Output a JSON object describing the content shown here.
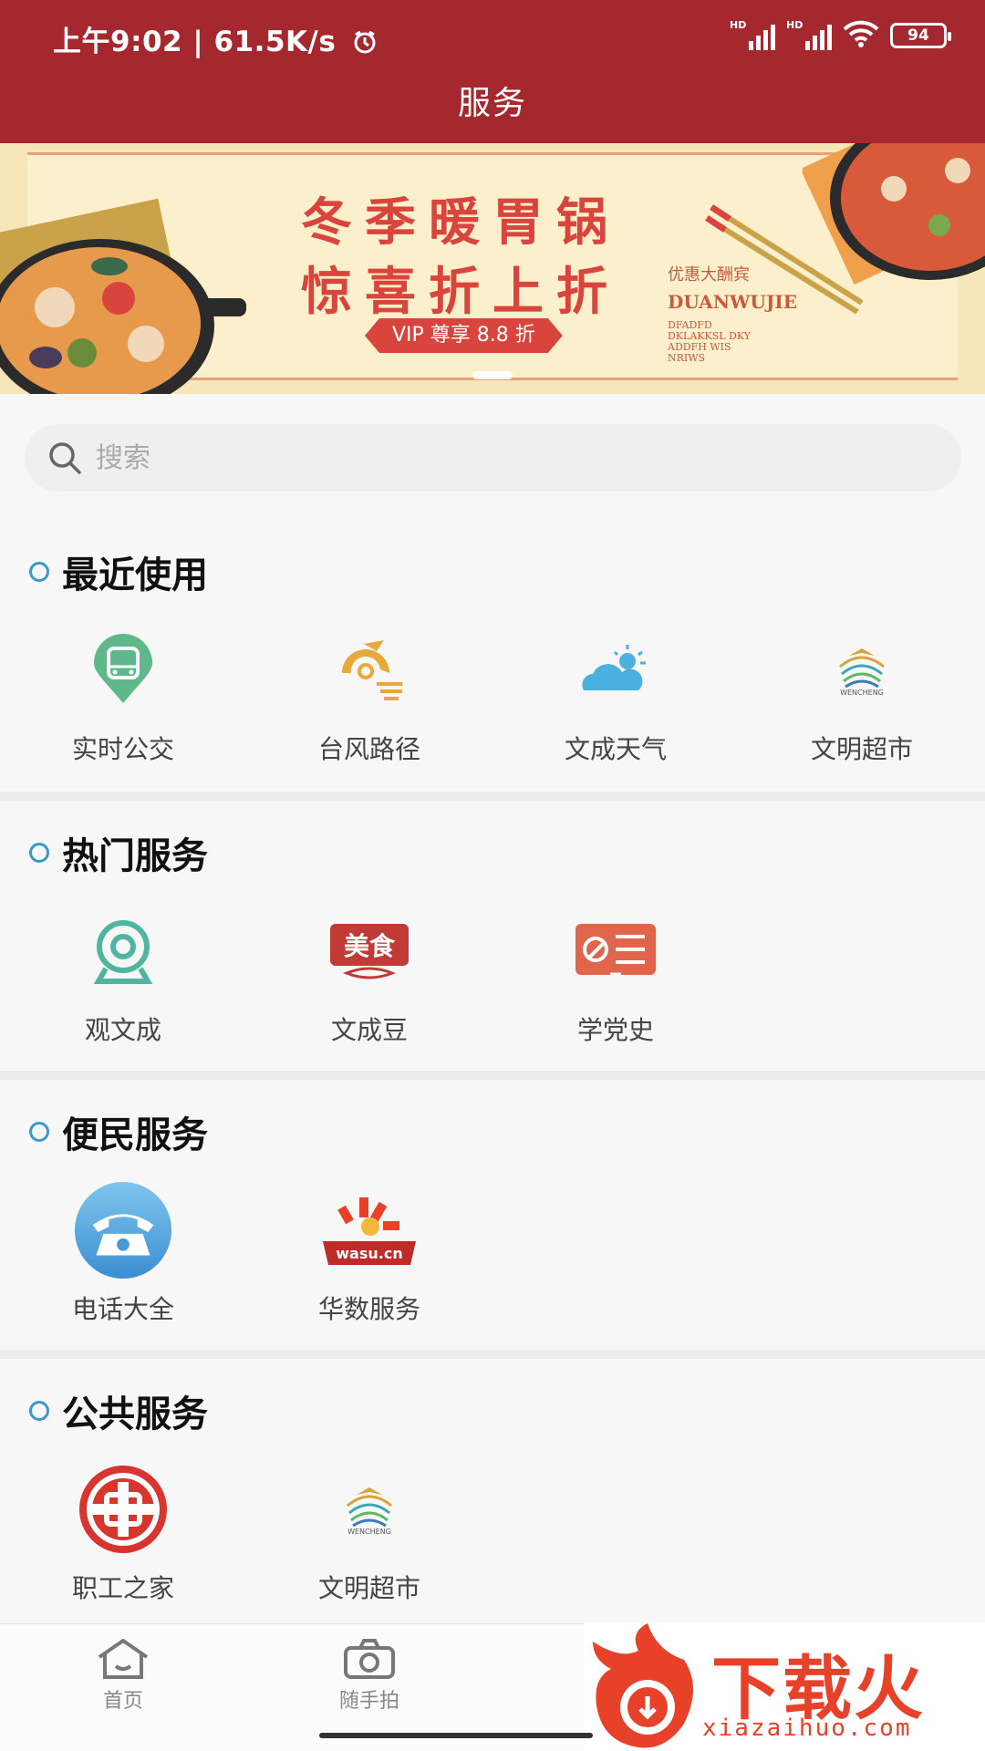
{
  "status_bar": {
    "time": "上午9:02",
    "speed": "61.5K/s",
    "signal_label": "HD",
    "battery": "94"
  },
  "header": {
    "title": "服务"
  },
  "banner": {
    "line1": "冬季暖胃锅",
    "line2": "惊喜折上折",
    "vip": "VIP 尊享 8.8 折",
    "brand_cn": "优惠大酬宾",
    "brand_en": "DUANWUJIE",
    "small_text": "DFADFD DKLAKKSL DKY ADDFH WIS NRIWS"
  },
  "search": {
    "placeholder": "搜索"
  },
  "sections": [
    {
      "title": "最近使用",
      "items": [
        {
          "label": "实时公交",
          "icon": "bus-icon"
        },
        {
          "label": "台风路径",
          "icon": "typhoon-icon"
        },
        {
          "label": "文成天气",
          "icon": "weather-icon"
        },
        {
          "label": "文明超市",
          "icon": "wencheng-logo-icon"
        }
      ]
    },
    {
      "title": "热门服务",
      "items": [
        {
          "label": "观文成",
          "icon": "webcam-icon"
        },
        {
          "label": "文成豆",
          "icon": "food-icon"
        },
        {
          "label": "学党史",
          "icon": "party-history-icon"
        }
      ]
    },
    {
      "title": "便民服务",
      "items": [
        {
          "label": "电话大全",
          "icon": "telephone-icon"
        },
        {
          "label": "华数服务",
          "icon": "wasu-icon",
          "logo_text": "wasu.cn"
        }
      ]
    },
    {
      "title": "公共服务",
      "items": [
        {
          "label": "职工之家",
          "icon": "union-icon"
        },
        {
          "label": "文明超市",
          "icon": "wencheng-logo-icon"
        }
      ]
    }
  ],
  "wencheng_logo_text": "WENCHENG",
  "food_logo_text": "美食",
  "bottom_nav": [
    {
      "label": "首页",
      "icon": "home-icon"
    },
    {
      "label": "随手拍",
      "icon": "camera-icon"
    }
  ],
  "watermark": {
    "cn": "下载火",
    "en": "xiazaihuo.com"
  },
  "colors": {
    "primary": "#a5282e",
    "accent": "#3a9bc9"
  }
}
